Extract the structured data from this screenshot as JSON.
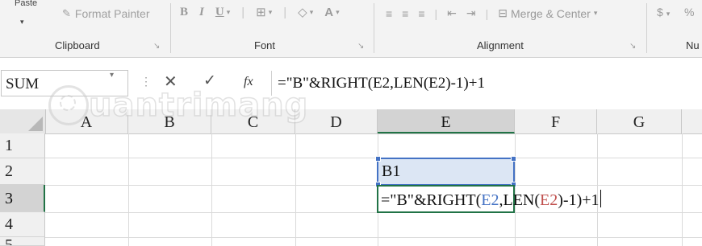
{
  "ribbon": {
    "paste_label": "Paste",
    "format_painter_label": "Format Painter",
    "font_buttons": {
      "bold": "B",
      "italic": "I",
      "underline": "U"
    },
    "merge_center_label": "Merge & Center",
    "currency_symbol": "$",
    "percent_symbol": "%",
    "groups": {
      "clipboard": "Clipboard",
      "font": "Font",
      "alignment": "Alignment",
      "number": "Nu"
    }
  },
  "formula_bar": {
    "name_box": "SUM",
    "fx_label": "fx",
    "formula": "=\"B\"&RIGHT(E2,LEN(E2)-1)+1"
  },
  "grid": {
    "columns": [
      "A",
      "B",
      "C",
      "D",
      "E",
      "F",
      "G"
    ],
    "rows": [
      "1",
      "2",
      "3",
      "4",
      "5"
    ],
    "selected_column": "E",
    "selected_row": "3",
    "cells": {
      "E2": "B1",
      "E3_parts": {
        "p1": "=\"B\"&RIGHT(",
        "p2": "E2",
        "p3": ",LEN(",
        "p4": "E2",
        "p5": ")-1)+1"
      }
    }
  },
  "watermark": {
    "text": "uantrimang"
  },
  "colors": {
    "accent_green": "#217346",
    "selection_blue": "#4472c4",
    "ref_red": "#c0504d",
    "selection_fill": "#dce6f4"
  }
}
